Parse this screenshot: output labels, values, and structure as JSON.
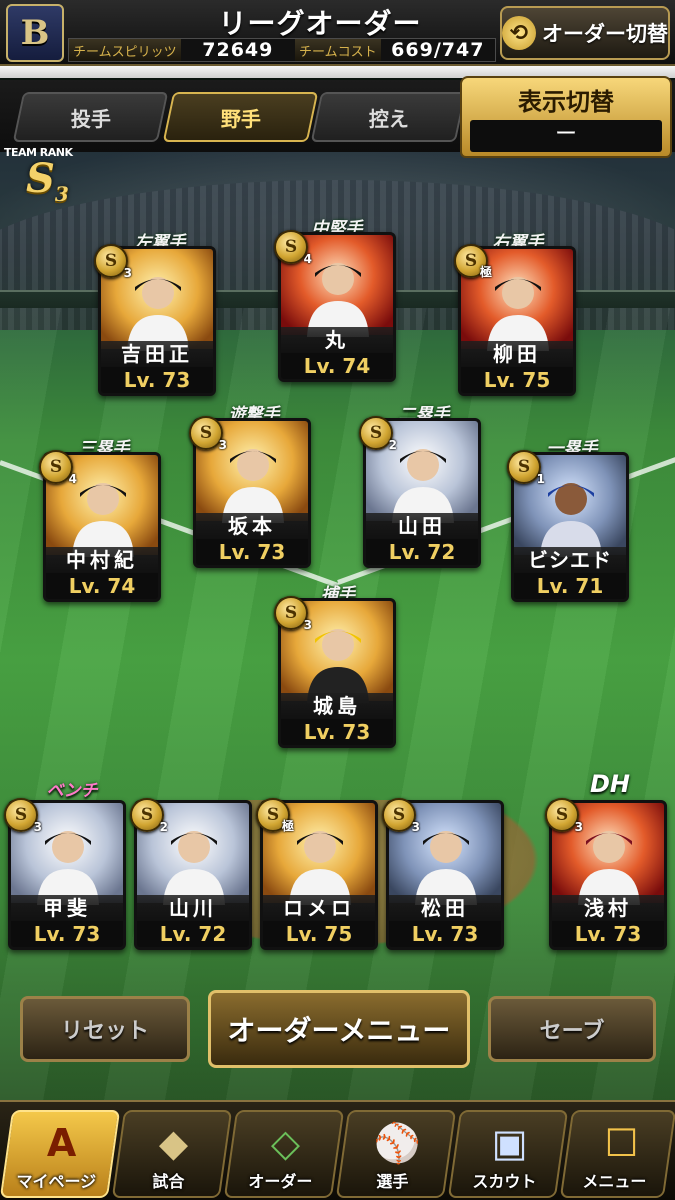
{
  "header": {
    "team_logo_letter": "B",
    "title": "リーグオーダー",
    "spirit_label": "チームスピリッツ",
    "spirit_value": "72649",
    "cost_label": "チームコスト",
    "cost_value": "669/747",
    "order_switch_label": "オーダー切替"
  },
  "tabs": {
    "pitcher": "投手",
    "fielder": "野手",
    "reserve": "控え",
    "active": "fielder"
  },
  "display_switch": {
    "title": "表示切替",
    "value": "ー"
  },
  "team_rank": {
    "caption": "TEAM RANK",
    "rank": "S",
    "rank_sub": "3"
  },
  "lineup": {
    "left_field": {
      "position": "左翼手",
      "name": "吉田正",
      "level": "Lv. 73",
      "badge": "S",
      "badge_sub": "3"
    },
    "center_field": {
      "position": "中堅手",
      "name": "丸",
      "level": "Lv. 74",
      "badge": "S",
      "badge_sub": "4"
    },
    "right_field": {
      "position": "右翼手",
      "name": "柳田",
      "level": "Lv. 75",
      "badge": "S",
      "badge_sub": "極"
    },
    "shortstop": {
      "position": "遊撃手",
      "name": "坂本",
      "level": "Lv. 73",
      "badge": "S",
      "badge_sub": "3"
    },
    "second_base": {
      "position": "二塁手",
      "name": "山田",
      "level": "Lv. 72",
      "badge": "S",
      "badge_sub": "2"
    },
    "third_base": {
      "position": "三塁手",
      "name": "中村紀",
      "level": "Lv. 74",
      "badge": "S",
      "badge_sub": "4"
    },
    "first_base": {
      "position": "一塁手",
      "name": "ビシエド",
      "level": "Lv. 71",
      "badge": "S",
      "badge_sub": "1"
    },
    "catcher": {
      "position": "捕手",
      "name": "城島",
      "level": "Lv. 73",
      "badge": "S",
      "badge_sub": "3"
    }
  },
  "bench": {
    "label": "ベンチ",
    "players": [
      {
        "name": "甲斐",
        "level": "Lv. 73",
        "badge": "S",
        "badge_sub": "3"
      },
      {
        "name": "山川",
        "level": "Lv. 72",
        "badge": "S",
        "badge_sub": "2"
      },
      {
        "name": "ロメロ",
        "level": "Lv. 75",
        "badge": "S",
        "badge_sub": "極"
      },
      {
        "name": "松田",
        "level": "Lv. 73",
        "badge": "S",
        "badge_sub": "3"
      }
    ]
  },
  "dh": {
    "label": "DH",
    "name": "浅村",
    "level": "Lv. 73",
    "badge": "S",
    "badge_sub": "3"
  },
  "actions": {
    "reset": "リセット",
    "order_menu": "オーダーメニュー",
    "save": "セーブ"
  },
  "nav": {
    "mypage": "マイページ",
    "mypage_icon_text": "A",
    "match": "試合",
    "order": "オーダー",
    "players": "選手",
    "scout": "スカウト",
    "menu": "メニュー"
  }
}
